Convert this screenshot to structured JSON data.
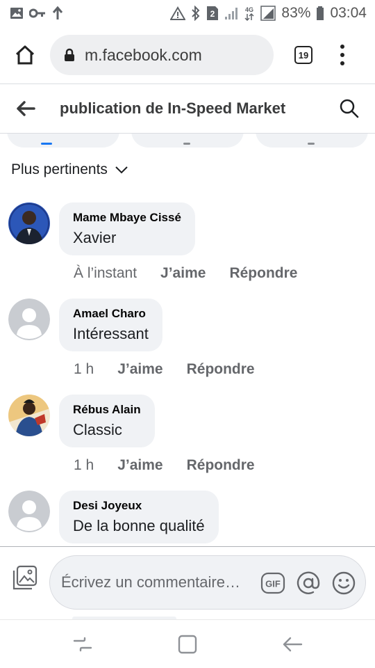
{
  "status_bar": {
    "left_icons": [
      "image-icon",
      "key-icon",
      "upload-icon"
    ],
    "right_icons": [
      "alert-icon",
      "bluetooth-icon",
      "sim-icon",
      "signal-icon",
      "network-icon",
      "signal-icon",
      "battery-icon"
    ],
    "sim_number": "2",
    "battery": "83%",
    "time": "03:04"
  },
  "browser": {
    "url": "m.facebook.com",
    "tab_count": "19"
  },
  "header": {
    "title": "publication de In-Speed Market"
  },
  "sort": {
    "label": "Plus pertinents"
  },
  "comments": [
    {
      "author": "Mame Mbaye Cissé",
      "text": "Xavier",
      "time": "À l’instant",
      "like": "J’aime",
      "reply": "Répondre",
      "avatar": "avatar-photo"
    },
    {
      "author": "Amael Charo",
      "text": "Intéressant",
      "time": "1 h",
      "like": "J’aime",
      "reply": "Répondre",
      "avatar": "default-avatar"
    },
    {
      "author": "Rébus Alain",
      "text": "Classic",
      "time": "1 h",
      "like": "J’aime",
      "reply": "Répondre",
      "avatar": "avatar-photo"
    },
    {
      "author": "Desi Joyeux",
      "text": "De la bonne qualité",
      "avatar": "default-avatar"
    }
  ],
  "composer": {
    "placeholder": "Écrivez un commentaire…",
    "gif_label": "GIF"
  },
  "colors": {
    "bubble": "#f0f2f5",
    "secondary_text": "#65676b",
    "primary_text": "#050505",
    "accent": "#1877f2"
  }
}
